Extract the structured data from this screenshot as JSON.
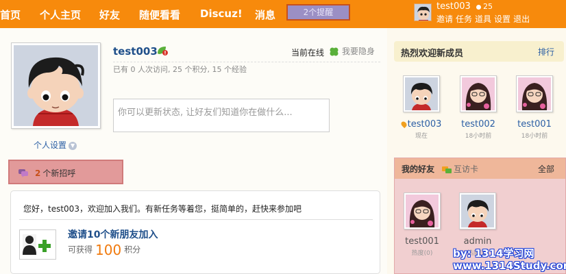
{
  "nav": {
    "items": [
      "首页",
      "个人主页",
      "好友",
      "随便看看",
      "Discuz!",
      "消息"
    ],
    "notice_label": "2个提醒",
    "username": "test003",
    "coins": "25",
    "links": [
      "邀请",
      "任务",
      "道具",
      "设置",
      "退出"
    ]
  },
  "profile": {
    "name": "test003",
    "online_label": "当前在线",
    "invisible_label": "我要隐身",
    "stats": "已有  0 人次访问, 25 个积分, 15 个经验",
    "status_placeholder": "你可以更新状态, 让好友们知道你在做什么...",
    "settings_label": "个人设置"
  },
  "greetings": {
    "count": "2",
    "label": "个新招呼"
  },
  "task": {
    "welcome": "您好，test003，欢迎加入我们。有新任务等着您，挺简单的，赶快来参加吧",
    "title": "邀请10个新朋友加入",
    "reward_prefix": "可获得",
    "reward_value": "100",
    "reward_unit": "积分"
  },
  "new_members": {
    "title": "热烈欢迎新成员",
    "rank_label": "排行",
    "members": [
      {
        "name": "test003",
        "time": "现在"
      },
      {
        "name": "test002",
        "time": "18小时前"
      },
      {
        "name": "test001",
        "time": "18小时前"
      }
    ]
  },
  "friends": {
    "title": "我的好友",
    "card_label": "互访卡",
    "all_label": "全部",
    "items": [
      {
        "name": "test001",
        "score": "热度(0)"
      },
      {
        "name": "admin",
        "score": "热度(0)"
      }
    ]
  },
  "watermark": {
    "line1": "by: 1314学习网",
    "line2": "www.1314Study.com"
  },
  "colors": {
    "nav_bg": "#f78a0c",
    "link": "#2a5ea4",
    "accent": "#f07a0e"
  }
}
